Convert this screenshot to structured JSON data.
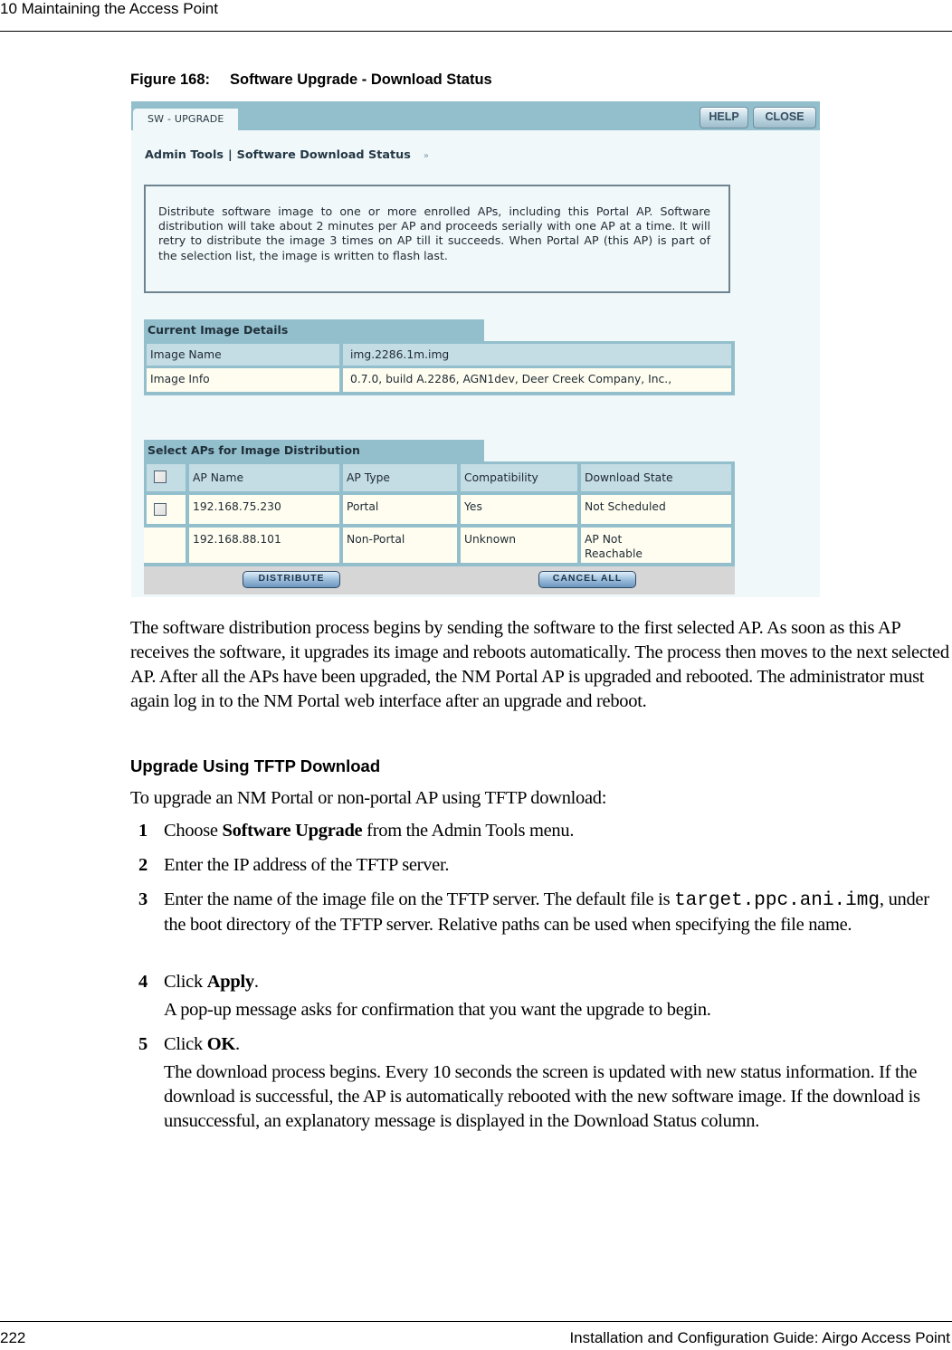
{
  "page": {
    "running_header": "10  Maintaining the Access Point",
    "page_number": "222",
    "book_title": "Installation and Configuration Guide: Airgo Access Point"
  },
  "figure": {
    "number": "Figure 168:",
    "title": "Software Upgrade - Download Status"
  },
  "ui": {
    "tab_label": "SW - UPGRADE",
    "help_button": "HELP",
    "close_button": "CLOSE",
    "breadcrumb": {
      "parent": "Admin Tools",
      "separator": "|",
      "current": "Software Download Status",
      "arrows": "»"
    },
    "info_text": "Distribute software image to one or more enrolled APs, including this Portal AP. Software distribution will take about 2 minutes per AP and proceeds serially with one AP at a time. It will retry to distribute the image 3 times on AP till it succeeds. When Portal AP (this AP) is part of the selection list, the image is written to flash last.",
    "current_image": {
      "title": "Current Image Details",
      "rows": [
        {
          "label": "Image Name",
          "value": "img.2286.1m.img"
        },
        {
          "label": "Image Info",
          "value": "0.7.0, build A.2286, AGN1dev, Deer Creek Company, Inc.,"
        }
      ]
    },
    "ap_table": {
      "title": "Select APs for Image Distribution",
      "columns": [
        "AP Name",
        "AP Type",
        "Compatibility",
        "Download State"
      ],
      "select_all_checked": false,
      "rows": [
        {
          "has_checkbox": true,
          "checked": false,
          "name": "192.168.75.230",
          "type": "Portal",
          "compatibility": "Yes",
          "state": "Not Scheduled"
        },
        {
          "has_checkbox": false,
          "checked": false,
          "name": "192.168.88.101",
          "type": "Non-Portal",
          "compatibility": "Unknown",
          "state": "AP Not Reachable"
        }
      ]
    },
    "distribute_button": "DISTRIBUTE",
    "cancel_all_button": "CANCEL ALL"
  },
  "body": {
    "intro": "The software distribution process begins by sending the software to the first selected AP. As soon as this AP receives the software, it upgrades its image and reboots automatically. The process then moves to the next selected AP. After all the APs have been upgraded, the NM Portal AP is upgraded and rebooted. The administrator must again log in to the NM Portal web interface after an upgrade and reboot.",
    "subheading": "Upgrade Using TFTP Download",
    "lead": "To upgrade an NM Portal or non-portal AP using TFTP download:",
    "steps": [
      {
        "num": "1",
        "pre": "Choose ",
        "bold": "Software Upgrade",
        "post": " from the Admin Tools menu."
      },
      {
        "num": "2",
        "text": "Enter the IP address of the TFTP server."
      },
      {
        "num": "3",
        "pre": "Enter the name of the image file on the TFTP server. The default file is ",
        "code": "target.ppc.ani.img",
        "post": ", under the boot directory of the TFTP server. Relative paths can be used when specifying the file name."
      },
      {
        "num": "4",
        "pre": "Click ",
        "bold": "Apply",
        "post": ".",
        "result": "A pop-up message asks for confirmation that you want the upgrade to begin."
      },
      {
        "num": "5",
        "pre": "Click ",
        "bold": "OK",
        "post": ".",
        "result": "The download process begins. Every 10 seconds the screen is updated with new status information. If the download is successful, the AP is automatically rebooted with the new software image. If the download is unsuccessful, an explanatory message is displayed in the Download Status column."
      }
    ]
  }
}
